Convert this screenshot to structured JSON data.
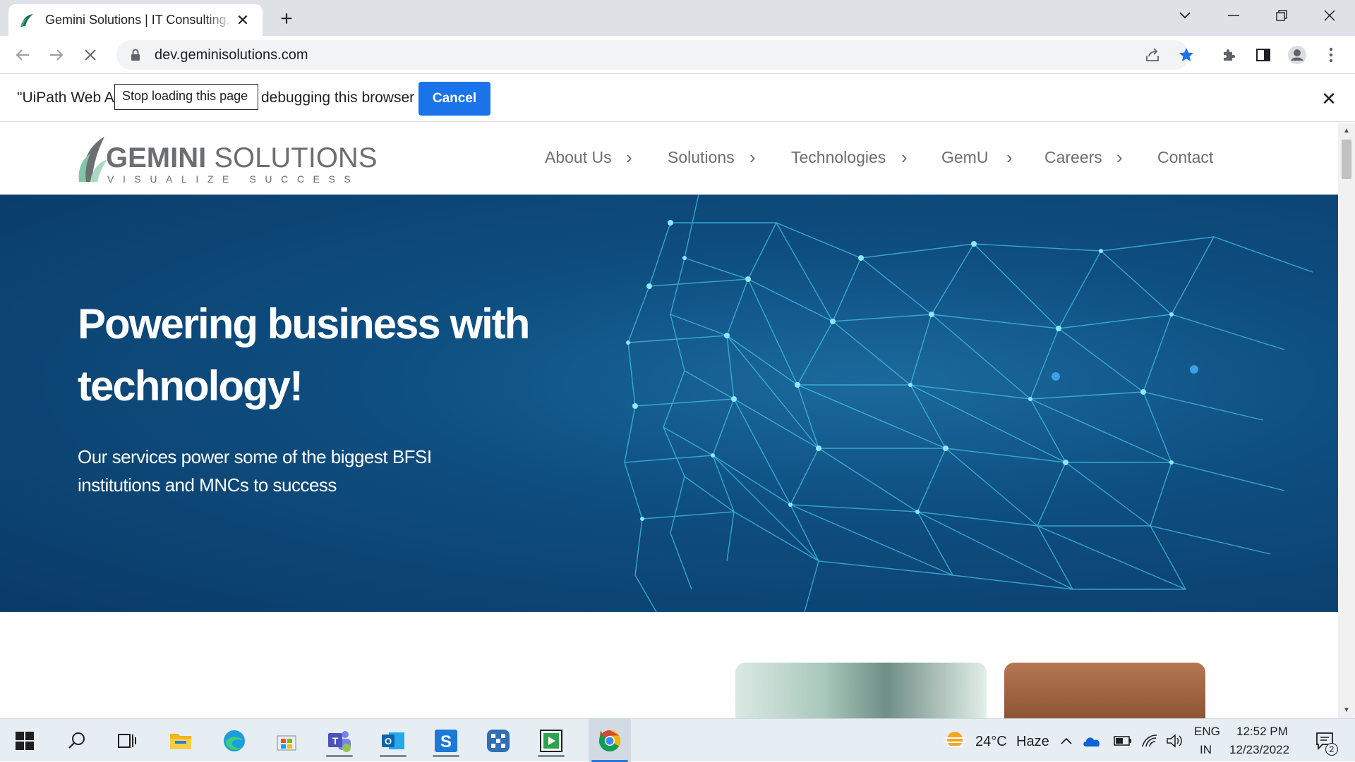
{
  "browser": {
    "tab_title": "Gemini Solutions | IT Consulting, Software Development",
    "url": "dev.geminisolutions.com"
  },
  "infobar": {
    "text_start": "\"UiPath Web Au",
    "text_end": "debugging this browser",
    "tooltip": "Stop loading this page",
    "cancel_label": "Cancel"
  },
  "site": {
    "logo_main_bold": "GEMINI",
    "logo_main_light": " SOLUTIONS",
    "logo_tagline": "VISUALIZE SUCCESS",
    "nav": [
      {
        "label": "About Us"
      },
      {
        "label": "Solutions"
      },
      {
        "label": "Technologies"
      },
      {
        "label": "GemU"
      },
      {
        "label": "Careers"
      },
      {
        "label": "Contact"
      }
    ],
    "hero_title": "Powering business with technology!",
    "hero_subtitle": "Our services power some of the biggest BFSI institutions and MNCs to success"
  },
  "taskbar": {
    "weather_temp": "24°C",
    "weather_desc": "Haze",
    "lang_top": "ENG",
    "lang_bottom": "IN",
    "time": "12:52 PM",
    "date": "12/23/2022",
    "notification_count": "2"
  },
  "colors": {
    "accent_blue": "#1a73e8",
    "hero_bg": "#0e4e80",
    "nav_gray": "#6d6e71"
  }
}
